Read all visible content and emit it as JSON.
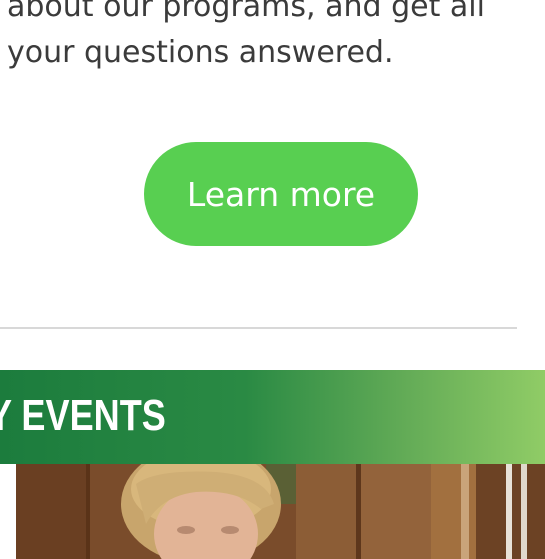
{
  "intro": {
    "line1": "about our programs, and get all",
    "line2": "your questions answered."
  },
  "cta": {
    "label": "Learn more",
    "color": "#58cf51"
  },
  "events": {
    "title": "Y EVENTS",
    "gradient_start": "#1c7c3d",
    "gradient_end": "#90cc66"
  },
  "photo": {
    "subject": "woman with blonde hair in wood-paneled room"
  }
}
